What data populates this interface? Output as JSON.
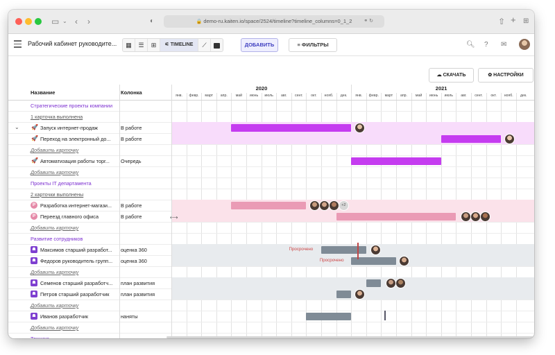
{
  "browser": {
    "url": "demo-ru.kaiten.io/space/2524/timeline?timeline_columns=0_1_2"
  },
  "toolbar": {
    "workspace_title": "Рабочий кабинет руководите...",
    "view_timeline_label": "TIMELINE",
    "add_label": "ДОБАВИТЬ",
    "filters_label": "ФИЛЬТРЫ"
  },
  "actions": {
    "download_label": "СКАЧАТЬ",
    "settings_label": "НАСТРОЙКИ"
  },
  "table": {
    "col_name": "Название",
    "col_column": "Колонка"
  },
  "timeline": {
    "years": [
      "2020",
      "2021"
    ],
    "months": [
      "янв.",
      "февр.",
      "март",
      "апр.",
      "май",
      "июнь",
      "июль",
      "авг.",
      "сент.",
      "окт.",
      "нояб.",
      "дек.",
      "янв.",
      "февр.",
      "март",
      "апр.",
      "май",
      "июнь",
      "июль",
      "авг.",
      "сент.",
      "окт.",
      "нояб.",
      "дек."
    ]
  },
  "rows": [
    {
      "type": "section",
      "text": "Стратегические проекты компании"
    },
    {
      "type": "done",
      "text": "1 карточка выполнена"
    },
    {
      "type": "card",
      "icon": "rocket",
      "name": "Запуск интернет-продаж",
      "column": "В работе",
      "expanded": true
    },
    {
      "type": "card",
      "icon": "rocket",
      "name": "Переход на электронный до...",
      "column": "В работе"
    },
    {
      "type": "add",
      "text": "Добавить карточку"
    },
    {
      "type": "card",
      "icon": "rocket",
      "name": "Автоматизация работы торг...",
      "column": "Очередь"
    },
    {
      "type": "add",
      "text": "Добавить карточку"
    },
    {
      "type": "section",
      "text": "Проекты IT департамента"
    },
    {
      "type": "done",
      "text": "2 карточки выполнены"
    },
    {
      "type": "card",
      "icon": "P",
      "name": "Разработка интернет-магази...",
      "column": "В работе"
    },
    {
      "type": "card",
      "icon": "P",
      "name": "Переезд главного офиса",
      "column": "В работе"
    },
    {
      "type": "add",
      "text": "Добавить карточку"
    },
    {
      "type": "section",
      "text": "Развитие сотрудников"
    },
    {
      "type": "card",
      "icon": "card",
      "name": "Максимов старший разработ...",
      "column": "оценка 360"
    },
    {
      "type": "card",
      "icon": "card",
      "name": "Федоров руководитель групп...",
      "column": "оценка 360"
    },
    {
      "type": "add",
      "text": "Добавить карточку"
    },
    {
      "type": "card",
      "icon": "card",
      "name": "Семенов старший разработч...",
      "column": "план развития"
    },
    {
      "type": "card",
      "icon": "card",
      "name": "Петров старший разработчик",
      "column": "план развития"
    },
    {
      "type": "add",
      "text": "Добавить карточку"
    },
    {
      "type": "card",
      "icon": "card",
      "name": "Иванов разработчик",
      "column": "наняты"
    },
    {
      "type": "add",
      "text": "Добавить карточку"
    },
    {
      "type": "section",
      "text": "Техника"
    }
  ],
  "overdue_label": "Просрочено",
  "more_assignees": "+2",
  "colors": {
    "accent_purple": "#c53cf0",
    "pink": "#ea9bb5",
    "slate": "#7f8b96",
    "section": "#7c2fd0"
  }
}
